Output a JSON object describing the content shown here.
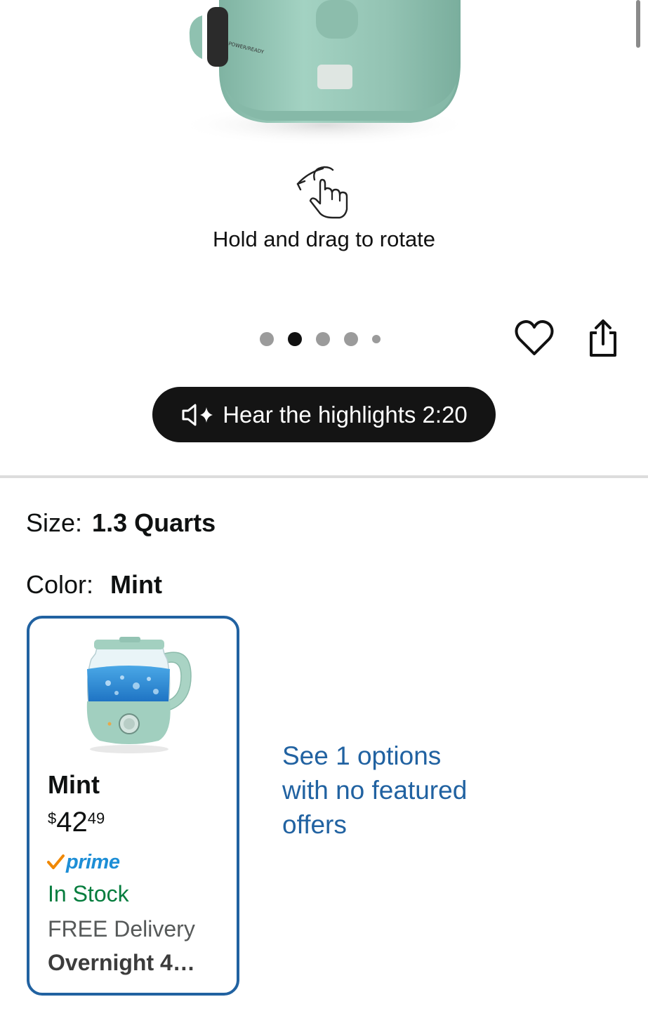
{
  "gallery": {
    "rotate_hint": "Hold and drag to rotate",
    "dots": [
      {
        "active": false,
        "size": "normal"
      },
      {
        "active": true,
        "size": "normal"
      },
      {
        "active": false,
        "size": "normal"
      },
      {
        "active": false,
        "size": "normal"
      },
      {
        "active": false,
        "size": "small"
      }
    ],
    "kettle_color": "#95c4b4"
  },
  "highlights": {
    "label": "Hear the highlights 2:20"
  },
  "variations": {
    "size_label": "Size:",
    "size_value": "1.3 Quarts",
    "color_label": "Color:",
    "color_value": "Mint"
  },
  "swatch": {
    "name": "Mint",
    "price_symbol": "$",
    "price_whole": "42",
    "price_cents": "49",
    "prime": "prime",
    "stock": "In Stock",
    "delivery": "FREE Delivery",
    "delivery_date": "Overnight 4…"
  },
  "more_options": {
    "label": "See 1 options with no featured offers"
  },
  "colors": {
    "link": "#2162a1",
    "in_stock": "#067d3e",
    "prime_blue": "#1d8ed6",
    "prime_check": "#f08804"
  }
}
